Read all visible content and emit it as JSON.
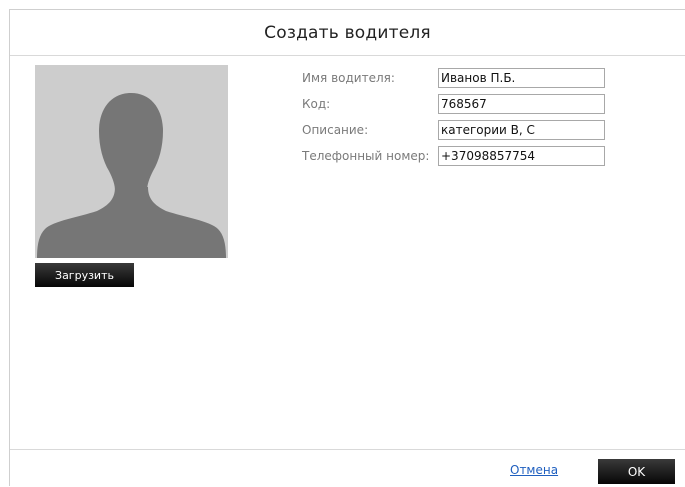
{
  "dialog": {
    "title": "Создать водителя"
  },
  "photo": {
    "icon": "user-silhouette-icon",
    "upload_label": "Загрузить"
  },
  "form": {
    "fields": [
      {
        "label": "Имя водителя:",
        "value": "Иванов П.Б."
      },
      {
        "label": "Код:",
        "value": "768567"
      },
      {
        "label": "Описание:",
        "value": "категории B, C"
      },
      {
        "label": "Телефонный номер:",
        "value": "+37098857754"
      }
    ]
  },
  "footer": {
    "cancel_label": "Отмена",
    "ok_label": "OK"
  },
  "colors": {
    "button_bg": "#111111",
    "link": "#1f5fbf",
    "photo_bg": "#cdcdcd",
    "silhouette": "#777777"
  }
}
